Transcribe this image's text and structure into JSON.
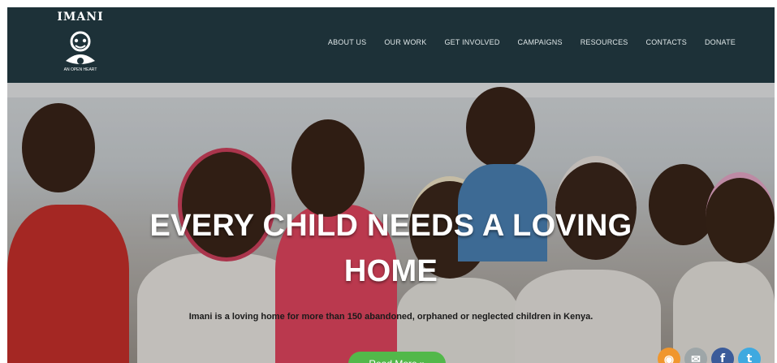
{
  "logo": {
    "word": "IMANI",
    "tagline": "AN OPEN HEART"
  },
  "nav": {
    "items": [
      {
        "label": "ABOUT US"
      },
      {
        "label": "OUR WORK"
      },
      {
        "label": "GET INVOLVED"
      },
      {
        "label": "CAMPAIGNS"
      },
      {
        "label": "RESOURCES"
      },
      {
        "label": "CONTACTS"
      },
      {
        "label": "DONATE"
      }
    ]
  },
  "hero": {
    "title": "EVERY CHILD NEEDS A LOVING HOME",
    "subtitle": "Imani is a loving home for more than 150 abandoned, orphaned or neglected children in Kenya.",
    "cta_label": "Read More »"
  },
  "social": [
    {
      "icon": "rss-icon",
      "glyph": "◉",
      "color": "#f0962d"
    },
    {
      "icon": "email-icon",
      "glyph": "✉",
      "color": "#9ea6a8"
    },
    {
      "icon": "facebook-icon",
      "glyph": "f",
      "color": "#3b5b9a"
    },
    {
      "icon": "twitter-icon",
      "glyph": "t",
      "color": "#3fa9e0"
    }
  ],
  "colors": {
    "navbar": "#1d3138",
    "accent": "#52b84a"
  }
}
